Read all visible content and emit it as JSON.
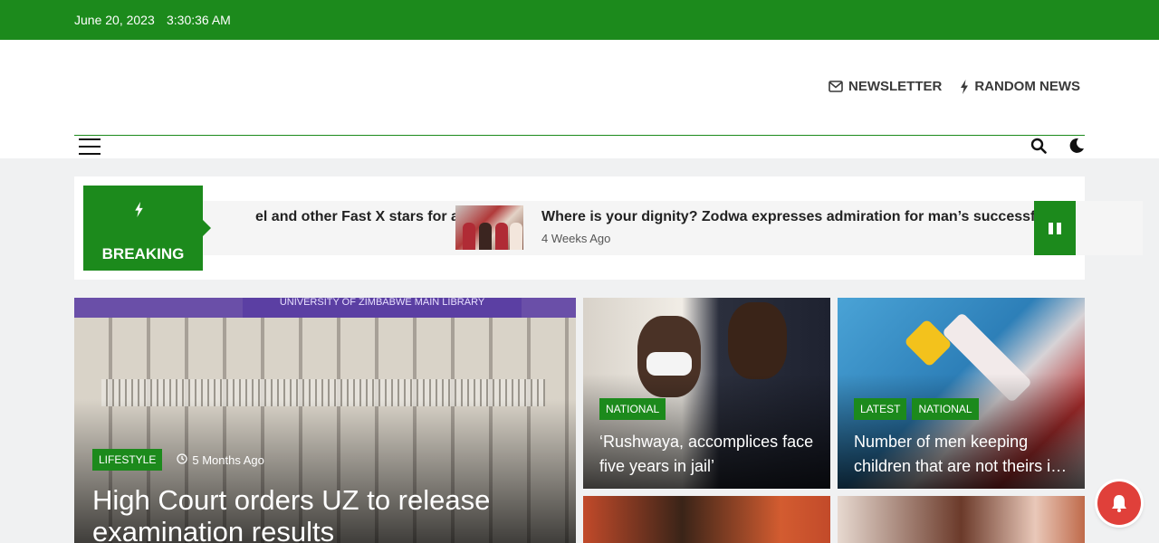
{
  "topbar": {
    "date": "June 20, 2023",
    "time": "3:30:36 AM"
  },
  "header": {
    "links": [
      {
        "label": "NEWSLETTER",
        "icon": "envelope-icon"
      },
      {
        "label": "RANDOM NEWS",
        "icon": "bolt-icon"
      }
    ]
  },
  "breaking": {
    "label": "BREAKING",
    "items": [
      {
        "title": "el and other Fast X stars for a party"
      },
      {
        "title": "Where is your dignity? Zodwa expresses admiration for man’s successful pe",
        "time": "4 Weeks Ago"
      }
    ]
  },
  "featured": {
    "tag": "LIFESTYLE",
    "time": "5 Months Ago",
    "title": "High Court orders UZ to release examination results",
    "sign": "UNIVERSITY OF ZIMBABWE MAIN LIBRARY"
  },
  "cards": [
    {
      "tags": [
        "NATIONAL"
      ],
      "title": "‘Rushwaya, accomplices face five years in jail’"
    },
    {
      "tags": [
        "LATEST",
        "NATIONAL"
      ],
      "title": "Number of men keeping children that are not theirs i…"
    }
  ],
  "colors": {
    "accent": "#1c8a1c",
    "notification": "#e0403a"
  }
}
